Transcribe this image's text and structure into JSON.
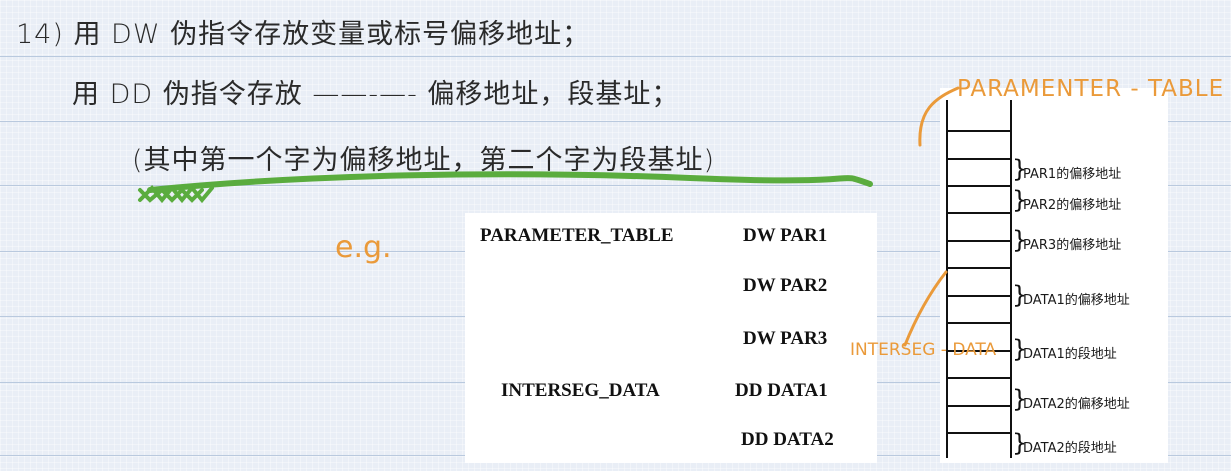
{
  "notes": {
    "line1": "14) 用 DW 伪指令存放变量或标号偏移地址；",
    "line2": "用 DD 伪指令存放 ——-—- 偏移地址，段基址；",
    "line3": "(其中第一个字为偏移地址，第二个字为段基址)",
    "eg": "e.g.",
    "table_title": "PARAMENTER - TABLE",
    "interseg_label": "INTERSEG - DATA"
  },
  "code_listing": [
    {
      "label": "PARAMETER_TABLE",
      "instruction": "DW PAR1"
    },
    {
      "label": "",
      "instruction": "DW PAR2"
    },
    {
      "label": "",
      "instruction": "DW PAR3"
    },
    {
      "label": "INTERSEG_DATA",
      "instruction": "DD DATA1"
    },
    {
      "label": "",
      "instruction": "DD DATA2"
    }
  ],
  "memory_labels": [
    "PAR1的偏移地址",
    "PAR2的偏移地址",
    "PAR3的偏移地址",
    "DATA1的偏移地址",
    "DATA1的段地址",
    "DATA2的偏移地址",
    "DATA2的段地址"
  ],
  "colors": {
    "highlight": "#5aac3e",
    "annotation": "#ea9a3a",
    "ink": "#2a2a2a"
  }
}
